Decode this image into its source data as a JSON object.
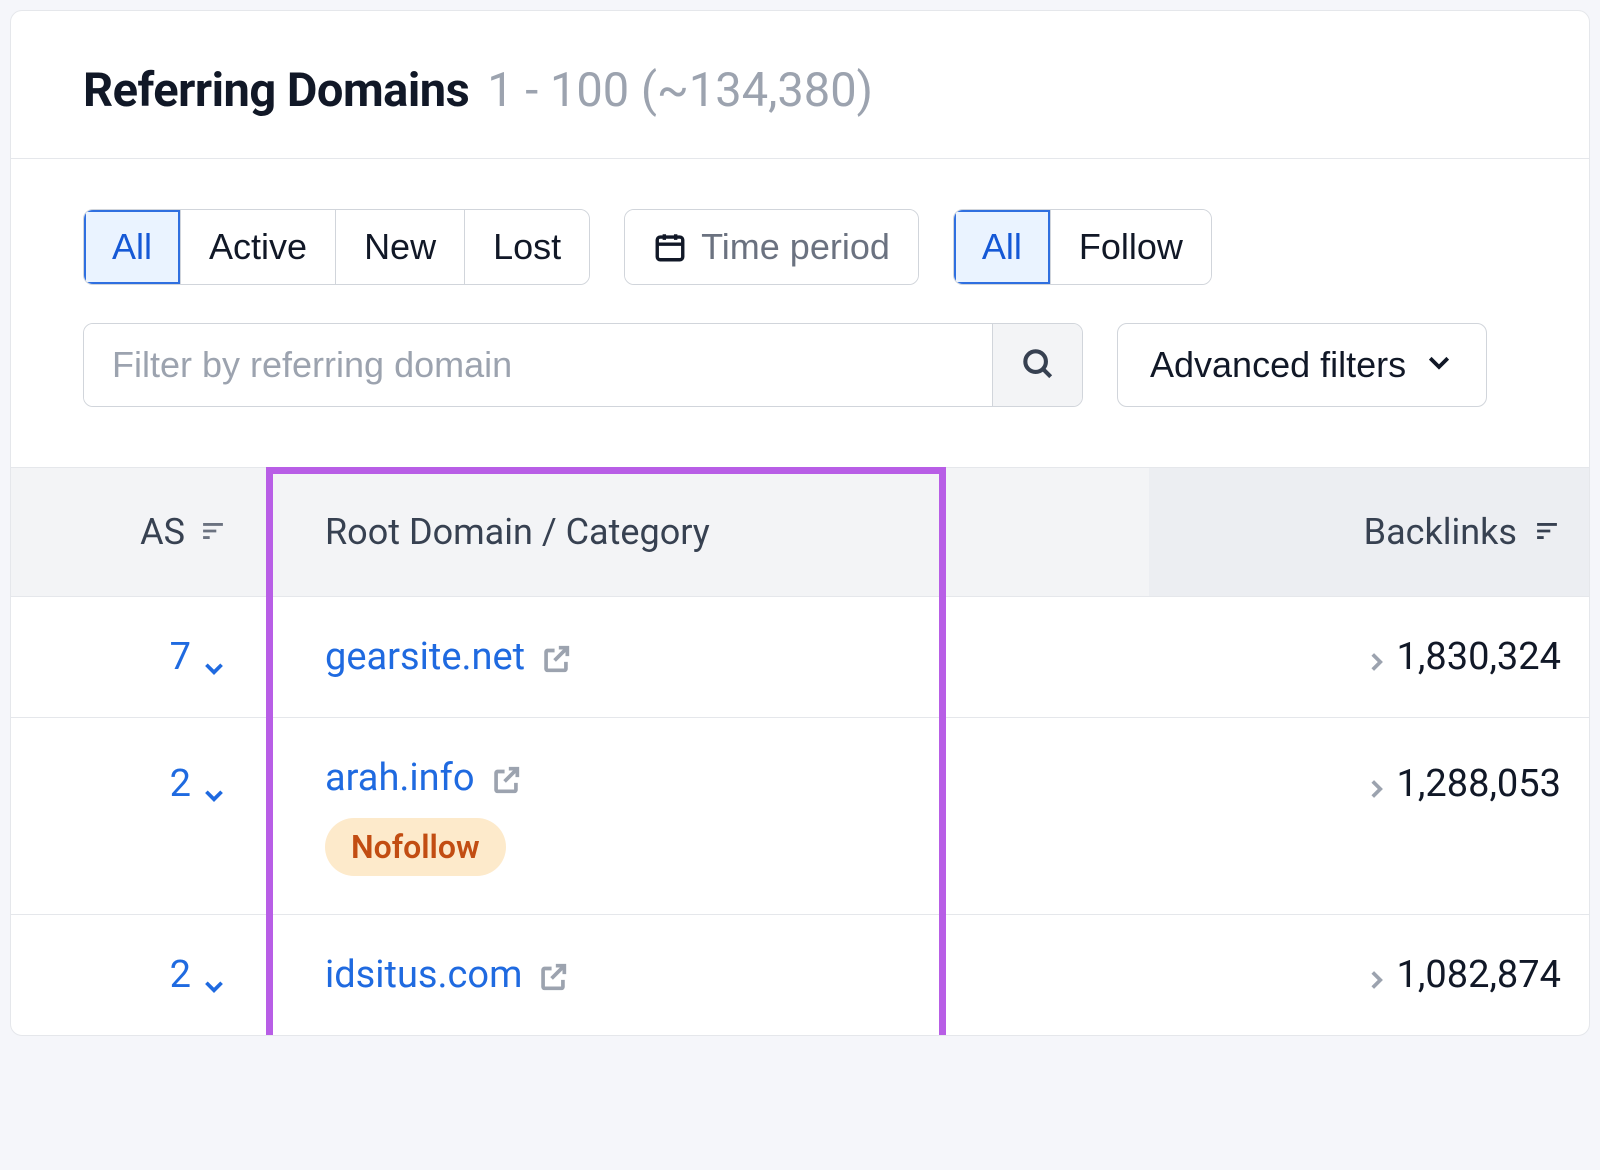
{
  "header": {
    "title": "Referring Domains",
    "range": "1 - 100 (~134,380)"
  },
  "filters": {
    "status": {
      "all": "All",
      "active": "Active",
      "new": "New",
      "lost": "Lost"
    },
    "time_period": "Time period",
    "follow": {
      "all": "All",
      "follow": "Follow"
    },
    "search_placeholder": "Filter by referring domain",
    "advanced": "Advanced filters"
  },
  "table": {
    "columns": {
      "as": "AS",
      "root_domain": "Root Domain / Category",
      "backlinks": "Backlinks"
    },
    "rows": [
      {
        "as": "7",
        "domain": "gearsite.net",
        "nofollow": "",
        "backlinks": "1,830,324"
      },
      {
        "as": "2",
        "domain": "arah.info",
        "nofollow": "Nofollow",
        "backlinks": "1,288,053"
      },
      {
        "as": "2",
        "domain": "idsitus.com",
        "nofollow": "",
        "backlinks": "1,082,874"
      }
    ]
  }
}
